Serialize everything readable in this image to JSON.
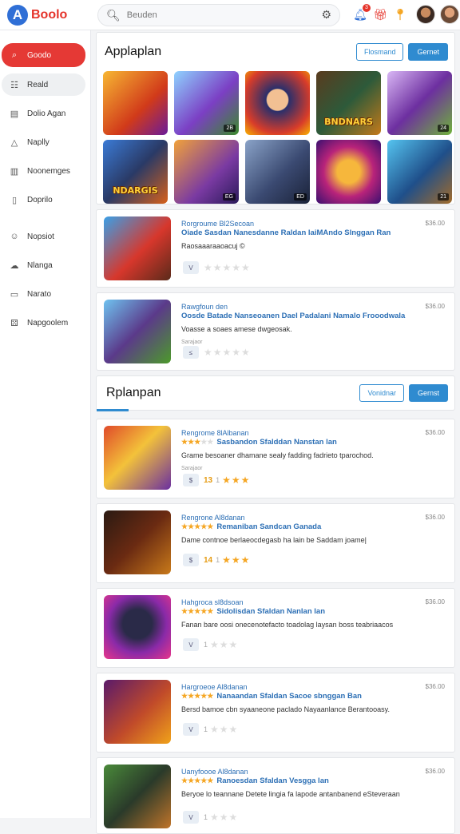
{
  "app": {
    "logo_letter": "A",
    "logo_text": "Boolo"
  },
  "search": {
    "placeholder": "Beuden"
  },
  "topbar": {
    "notif_count": "3"
  },
  "sidebar": {
    "items": [
      {
        "label": "Goodo",
        "icon": "search-icon"
      },
      {
        "label": "Reald",
        "icon": "grid-icon"
      },
      {
        "label": "Dolio Agan",
        "icon": "card-icon"
      },
      {
        "label": "Naplly",
        "icon": "tag-icon"
      },
      {
        "label": "Noonemges",
        "icon": "book-icon"
      },
      {
        "label": "Doprilo",
        "icon": "doc-icon"
      },
      {
        "label": "Nopsiot",
        "icon": "user-icon"
      },
      {
        "label": "Nlanga",
        "icon": "chat-icon"
      },
      {
        "label": "Narato",
        "icon": "message-icon"
      },
      {
        "label": "Napgoolem",
        "icon": "dice-icon"
      }
    ]
  },
  "featured": {
    "title": "Applaplan",
    "btn_outline": "Flosmand",
    "btn_solid": "Gernet",
    "tiles": [
      {
        "tag": "",
        "big": ""
      },
      {
        "tag": "2B",
        "big": ""
      },
      {
        "tag": "",
        "big": ""
      },
      {
        "tag": "",
        "big": "BNDNARS"
      },
      {
        "tag": "24",
        "big": ""
      },
      {
        "tag": "",
        "big": "NDARGIS"
      },
      {
        "tag": "EG",
        "big": ""
      },
      {
        "tag": "ED",
        "big": ""
      },
      {
        "tag": "",
        "big": ""
      },
      {
        "tag": "21",
        "big": ""
      }
    ]
  },
  "section2": {
    "title": "Rplanpan",
    "btn_outline": "Vonidnar",
    "btn_solid": "Gernst"
  },
  "cards": [
    {
      "title": "Rorgroume Bl2Secoan",
      "subtitle": "Oiade Sasdan Nanesdanne Raldan laiMAndo Slnggan Ran",
      "price": "$36.00",
      "desc": "Raosaaaraaoacuj ©",
      "meta": "",
      "chip": "V",
      "rating": "",
      "count": "",
      "stars": "★★★★★",
      "gold": 0
    },
    {
      "title": "Rawgfoun den",
      "subtitle": "Oosde Batade Nanseoanen Dael Padalani Namalo Frooodwala",
      "price": "$36.00",
      "desc": "Voasse a soaes amese dwgeosak.",
      "meta": "Sarajaor",
      "chip": "≤",
      "rating": "",
      "count": "",
      "stars": "★★★★★",
      "gold": 0
    },
    {
      "title": "Rengrome 8lAlbanan",
      "subtitle": "Sasbandon Sfalddan Nanstan lan",
      "price": "$36.00",
      "desc": "Grame besoaner dhamane sealy fadding fadrieto tparochod.",
      "meta": "Sarajaor",
      "chip": "$",
      "rating": "13",
      "count": "1",
      "stars": "★★★",
      "gold": 3
    },
    {
      "title": "Rengrone Al8danan",
      "subtitle": "Remaniban Sandcan Ganada",
      "price": "$36.00",
      "desc": "Dame contnoe berlaeocdegasb ha lain be Saddam joame|",
      "meta": "",
      "chip": "$",
      "rating": "14",
      "count": "1",
      "stars": "★★★",
      "gold": 5
    },
    {
      "title": "Hahgroca sl8dsoan",
      "subtitle": "Sidolisdan Sfaldan Nanlan lan",
      "price": "$36.00",
      "desc": "Fanan bare oosi onecenotefacto toadolag laysan boss teabriaacos",
      "meta": "",
      "chip": "V",
      "rating": "",
      "count": "1",
      "stars": "★★★",
      "gold": 5
    },
    {
      "title": "Hargroeoe Al8danan",
      "subtitle": "Nanaandan Sfaldan Sacoe sbnggan Ban",
      "price": "$36.00",
      "desc": "Bersd bamoe cbn syaaneone paclado Nayaanlance Berantooasy.",
      "meta": "",
      "chip": "V",
      "rating": "",
      "count": "1",
      "stars": "★★★",
      "gold": 5
    },
    {
      "title": "Uanyfoooe Al8danan",
      "subtitle": "Ranoesdan Sfaldan Vesgga lan",
      "price": "$36.00",
      "desc": "Beryoe lo teannane Detete lingia fa lapode antanbanend eSteveraan",
      "meta": "",
      "chip": "V",
      "rating": "",
      "count": "1",
      "stars": "★★★",
      "gold": 5
    }
  ]
}
